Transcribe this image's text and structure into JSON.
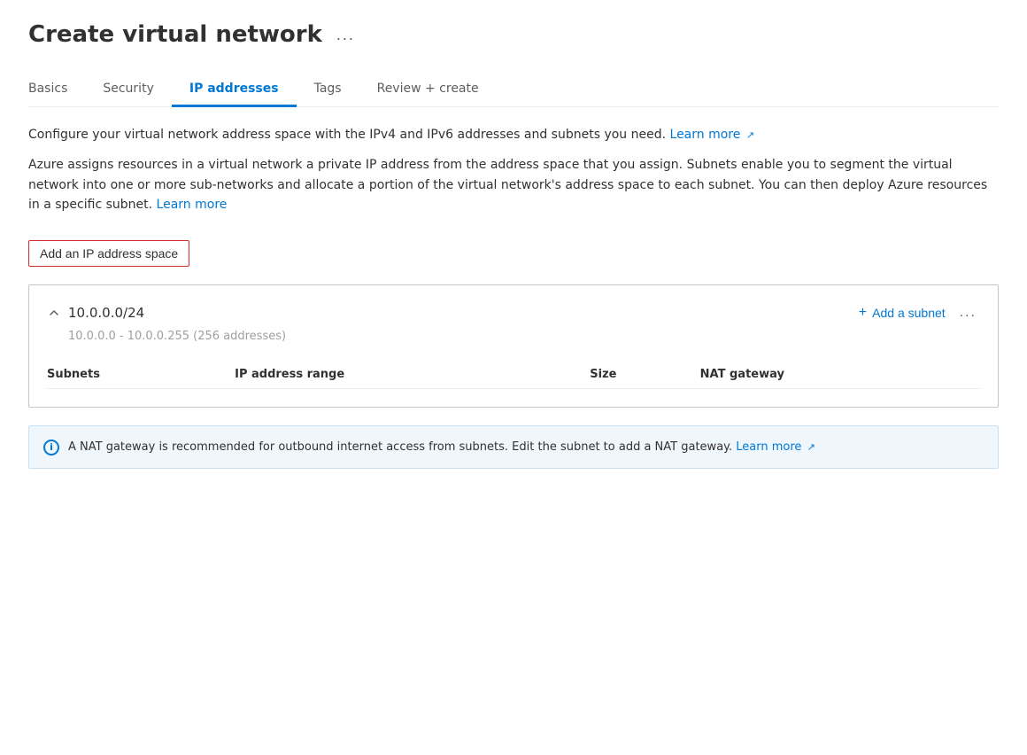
{
  "page": {
    "title": "Create virtual network",
    "ellipsis": "..."
  },
  "tabs": [
    {
      "id": "basics",
      "label": "Basics",
      "active": false
    },
    {
      "id": "security",
      "label": "Security",
      "active": false
    },
    {
      "id": "ip-addresses",
      "label": "IP addresses",
      "active": true
    },
    {
      "id": "tags",
      "label": "Tags",
      "active": false
    },
    {
      "id": "review-create",
      "label": "Review + create",
      "active": false
    }
  ],
  "description1": "Configure your virtual network address space with the IPv4 and IPv6 addresses and subnets you need.",
  "description1_learn_more": "Learn more",
  "description2": "Azure assigns resources in a virtual network a private IP address from the address space that you assign. Subnets enable you to segment the virtual network into one or more sub-networks and allocate a portion of the virtual network's address space to each subnet. You can then deploy Azure resources in a specific subnet.",
  "description2_learn_more": "Learn more",
  "add_ip_button": "Add an IP address space",
  "ip_space": {
    "cidr": "10.0.0.0/24",
    "range": "10.0.0.0 - 10.0.0.255 (256 addresses)",
    "add_subnet_label": "Add a subnet",
    "more_options": "...",
    "table_headers": [
      "Subnets",
      "IP address range",
      "Size",
      "NAT gateway"
    ],
    "rows": []
  },
  "info_banner": {
    "text": "A NAT gateway is recommended for outbound internet access from subnets. Edit the subnet to add a NAT gateway.",
    "learn_more": "Learn more"
  }
}
